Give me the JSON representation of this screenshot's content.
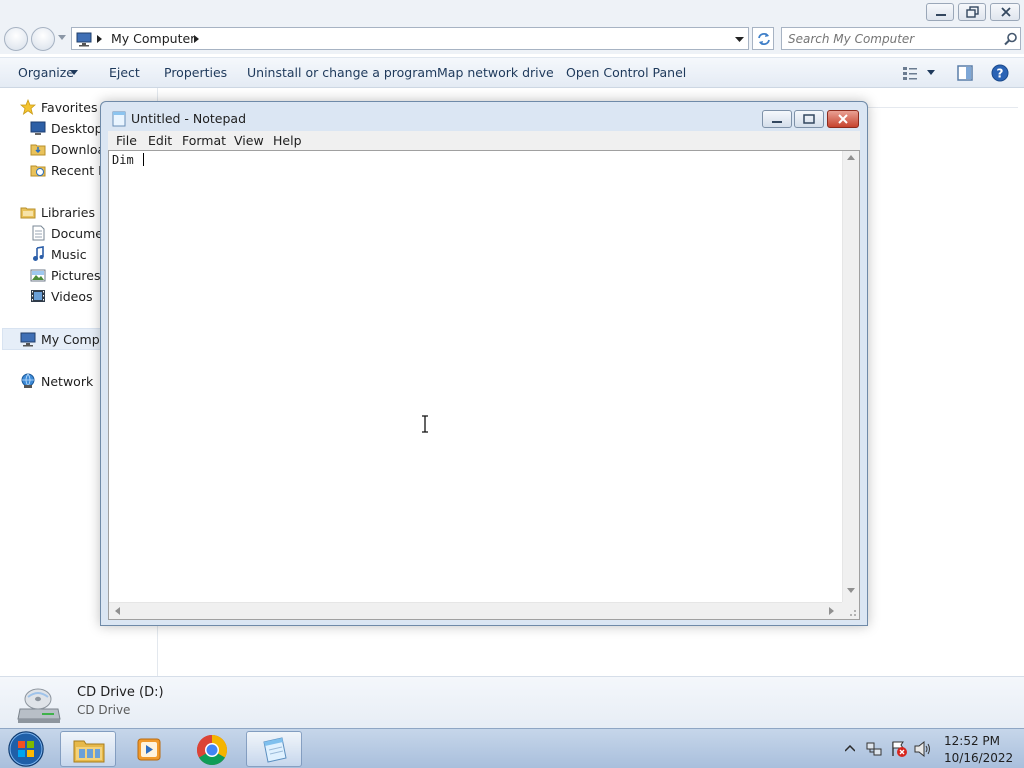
{
  "explorer": {
    "address": {
      "crumb": "My Computer"
    },
    "search": {
      "placeholder": "Search My Computer"
    },
    "toolbar": {
      "organize": "Organize",
      "eject": "Eject",
      "properties": "Properties",
      "uninstall": "Uninstall or change a program",
      "map_drive": "Map network drive",
      "control_panel": "Open Control Panel"
    },
    "nav": {
      "favorites": "Favorites",
      "desktop": "Desktop",
      "downloads": "Download",
      "recent": "Recent Pl",
      "libraries": "Libraries",
      "documents": "Documen",
      "music": "Music",
      "pictures": "Pictures",
      "videos": "Videos",
      "computer": "My Compu",
      "network": "Network"
    },
    "details": {
      "name": "CD Drive (D:)",
      "type": "CD Drive"
    }
  },
  "notepad": {
    "title": "Untitled - Notepad",
    "menu": [
      "File",
      "Edit",
      "Format",
      "View",
      "Help"
    ],
    "content": "Dim "
  },
  "taskbar": {
    "time": "12:52 PM",
    "date": "10/16/2022"
  },
  "icons": {
    "start": "windows-orb-icon",
    "explorer": "folder-icon",
    "media": "media-player-icon",
    "chrome": "chrome-icon",
    "notepad": "notepad-icon"
  }
}
